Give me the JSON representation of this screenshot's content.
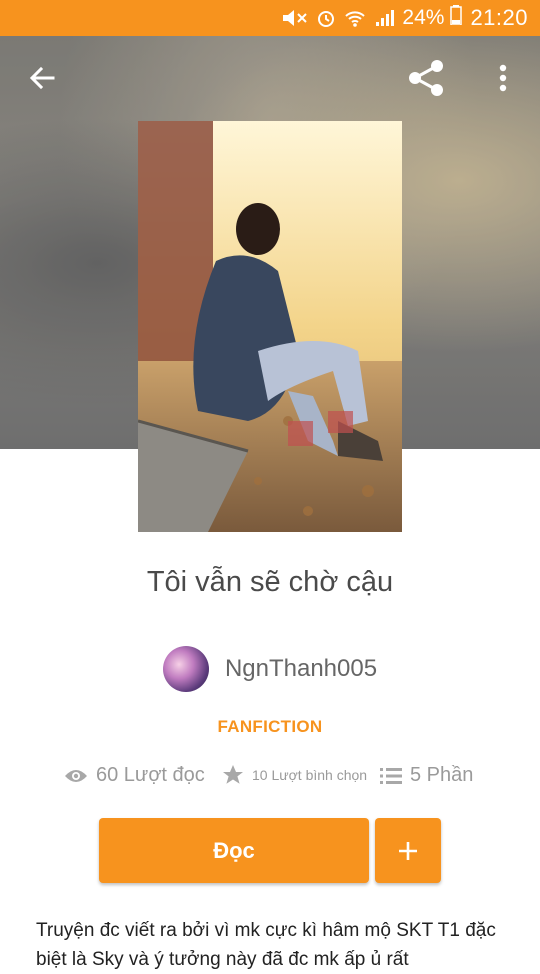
{
  "status_bar": {
    "battery": "24%",
    "time": "21:20",
    "icons": [
      "mute-icon",
      "alarm-icon",
      "wifi-icon",
      "signal-icon",
      "battery-icon"
    ]
  },
  "toolbar": {
    "back_icon": "arrow-left-icon",
    "share_icon": "share-icon",
    "more_icon": "more-vertical-icon"
  },
  "story": {
    "title": "Tôi vẫn sẽ chờ cậu",
    "author": "NgnThanh005",
    "category": "FANFICTION",
    "reads": "60 Lượt đọc",
    "votes": "10 Lượt bình chọn",
    "parts": "5 Phần",
    "read_label": "Đọc",
    "add_label": "+",
    "description": "Truyện đc viết ra bởi vì mk cực kì hâm mộ SKT T1 đặc biệt là Sky và ý tưởng này đã đc mk ấp ủ rất"
  },
  "colors": {
    "accent": "#f7931e",
    "title_text": "#4a4a4a",
    "meta_text": "#9a9a9a"
  }
}
